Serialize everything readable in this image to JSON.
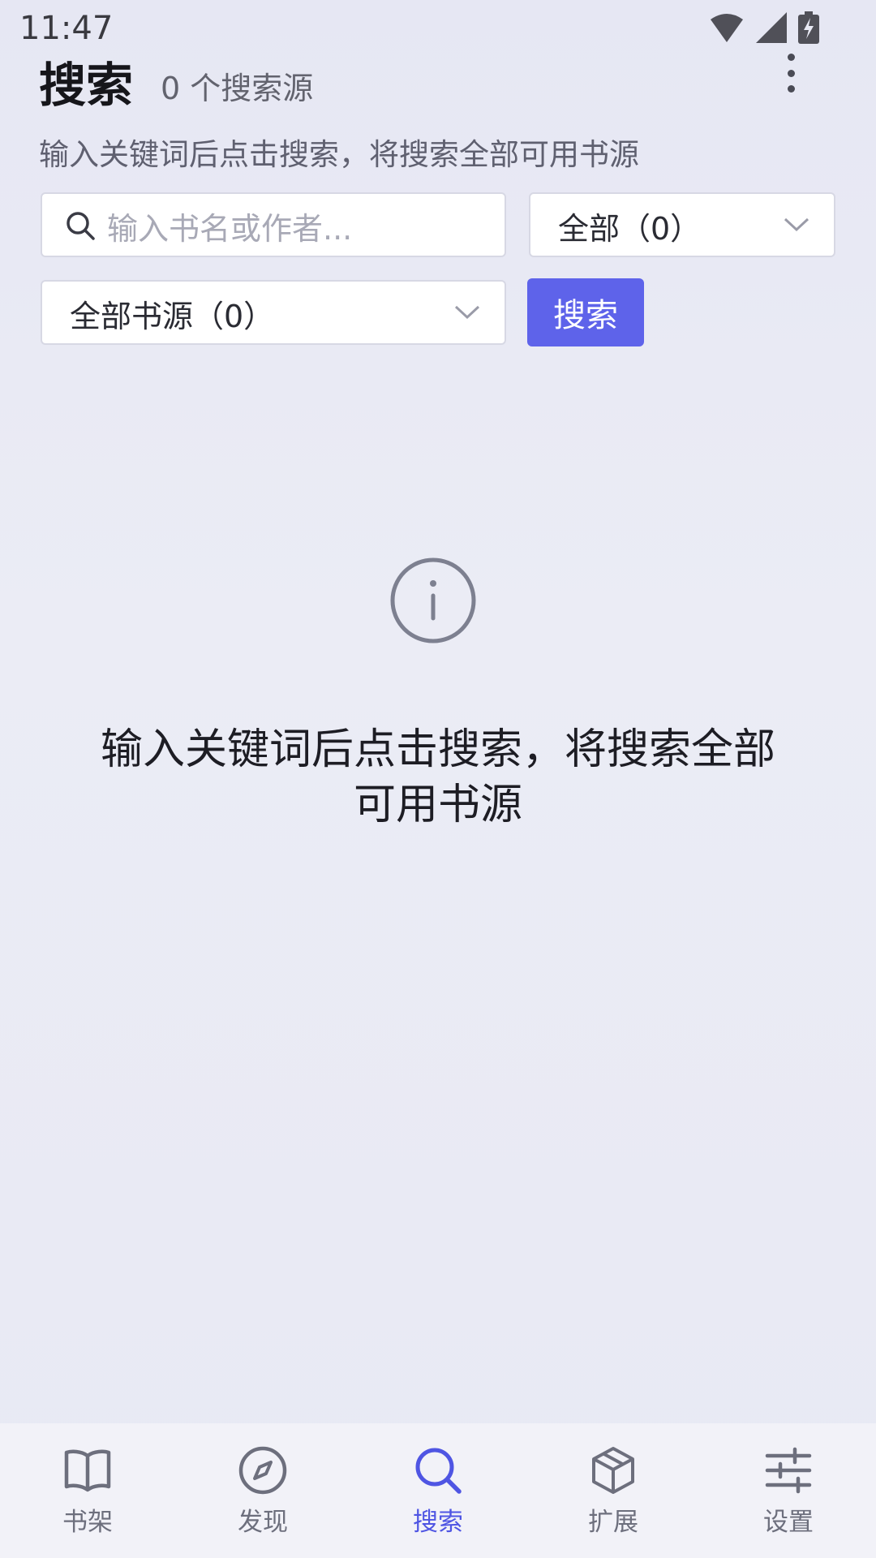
{
  "status_bar": {
    "time": "11:47",
    "icons": [
      "wifi-icon",
      "signal-icon",
      "battery-charging-icon"
    ]
  },
  "header": {
    "title": "搜索",
    "subtitle": "0 个搜索源",
    "menu_icon": "more-vertical-icon"
  },
  "hint": "输入关键词后点击搜索，将搜索全部可用书源",
  "search": {
    "placeholder": "输入书名或作者...",
    "value": "",
    "icon": "search-icon"
  },
  "category_select": {
    "selected": "全部（0）"
  },
  "source_select": {
    "selected": "全部书源（0）"
  },
  "search_button": {
    "label": "搜索"
  },
  "empty_state": {
    "icon": "info-circle-icon",
    "message": "输入关键词后点击搜索，将搜索全部可用书源"
  },
  "bottom_nav": {
    "items": [
      {
        "label": "书架",
        "icon": "book-open-icon",
        "active": false
      },
      {
        "label": "发现",
        "icon": "compass-icon",
        "active": false
      },
      {
        "label": "搜索",
        "icon": "search-icon",
        "active": true
      },
      {
        "label": "扩展",
        "icon": "package-icon",
        "active": false
      },
      {
        "label": "设置",
        "icon": "sliders-icon",
        "active": false
      }
    ]
  },
  "colors": {
    "accent": "#5e63ea",
    "active_nav": "#4f55e3",
    "background": "#e8e9f4"
  }
}
